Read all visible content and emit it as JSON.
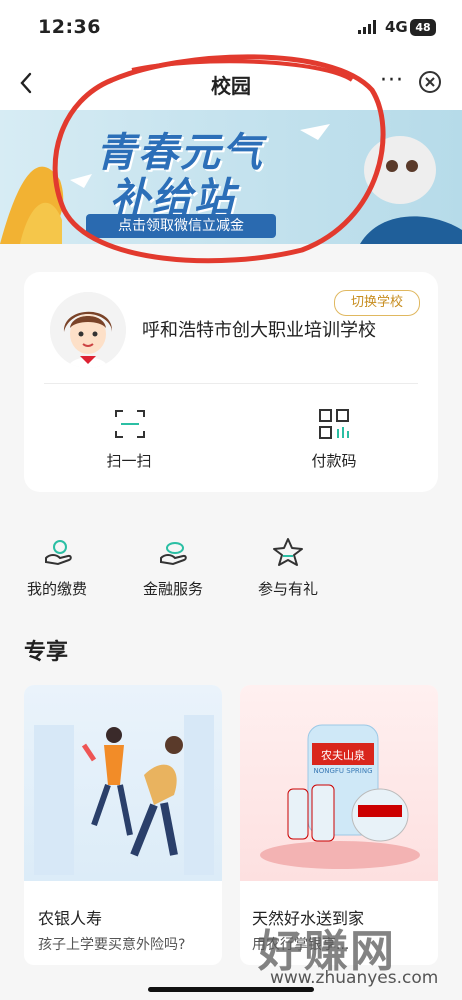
{
  "status_bar": {
    "time": "12:36",
    "network": "4G",
    "battery": "48"
  },
  "nav": {
    "title": "校园"
  },
  "banner": {
    "title_line1": "青春元气",
    "title_line2": "补给站",
    "subtitle": "点击领取微信立减金"
  },
  "school_card": {
    "switch_label": "切换学校",
    "school_name": "呼和浩特市创大职业培训学校",
    "actions": [
      {
        "label": "扫一扫",
        "icon": "scan-icon"
      },
      {
        "label": "付款码",
        "icon": "payment-code-icon"
      }
    ]
  },
  "services": [
    {
      "label": "我的缴费",
      "icon": "payment-icon"
    },
    {
      "label": "金融服务",
      "icon": "finance-icon"
    },
    {
      "label": "参与有礼",
      "icon": "star-icon"
    }
  ],
  "section_title": "专享",
  "tiles": [
    {
      "title": "农银人寿",
      "subtitle": "孩子上学要买意外险吗?"
    },
    {
      "title": "天然好水送到家",
      "subtitle": "用农行掌银享..."
    }
  ],
  "product": {
    "brand": "农夫山泉",
    "brand_en": "NONGFU SPRING"
  },
  "watermark": {
    "text": "好赚网",
    "url": "www.zhuanyes.com"
  },
  "colors": {
    "accent_gold": "#c78d1f",
    "banner_blue": "#2c6fb8",
    "circle_red": "#e23a2e"
  }
}
